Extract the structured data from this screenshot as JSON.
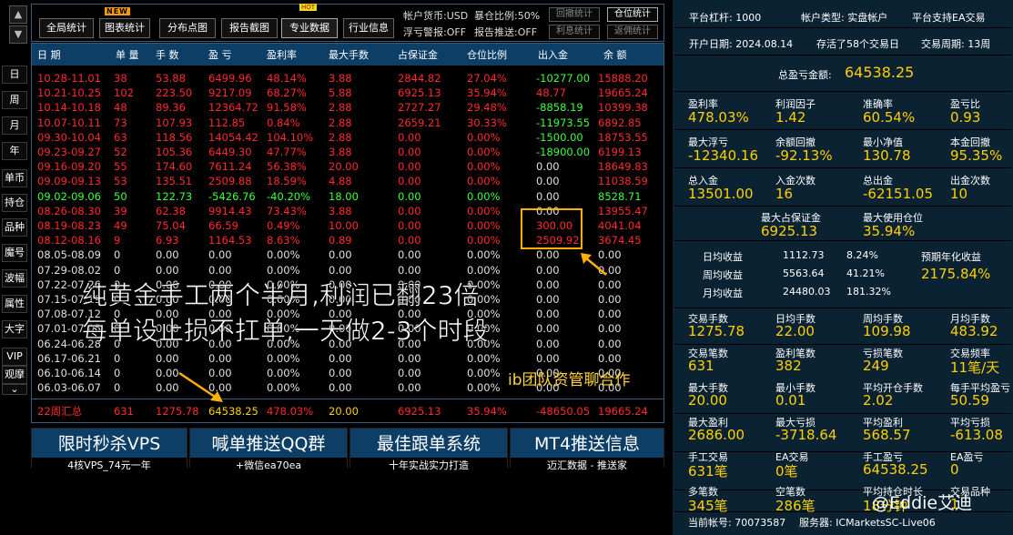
{
  "leftnav": {
    "up": "▲",
    "down": "▼",
    "items": [
      "日",
      "周",
      "月",
      "年",
      "单币",
      "持仓",
      "品种",
      "魔号",
      "波幅",
      "属性",
      "大字",
      "VIP",
      "观摩"
    ],
    "more": "⌄"
  },
  "toolbar": {
    "buttons": [
      "全局统计",
      "图表统计",
      "分布点图",
      "报告截图",
      "专业数据",
      "行业信息"
    ],
    "new_badge": "NEW",
    "hot_badge": "HOT",
    "currency": "帐户货币:USD",
    "exposure": "暴仓比例:50%",
    "floating_alert": "浮亏警报:OFF",
    "report_push": "报告推送:OFF",
    "btn_drawdown": "回撤统计",
    "btn_position": "仓位统计",
    "btn_profit": "利息统计",
    "btn_rebate": "返佣统计"
  },
  "table": {
    "headers": [
      "日 期",
      "单 量",
      "手 数",
      "盈 亏",
      "盈利率",
      "最大手数",
      "占保证金",
      "仓位比例",
      "出入金",
      "余 额"
    ],
    "rows": [
      {
        "c": "red",
        "date": "10.28-11.01",
        "orders": "38",
        "lots": "53.88",
        "pl": "6499.96",
        "rate": "48.14%",
        "maxlot": "3.88",
        "margin": "2844.82",
        "pos": "27.04%",
        "io": "-10277.00",
        "io_c": "green",
        "bal": "15888.20"
      },
      {
        "c": "red",
        "date": "10.21-10.25",
        "orders": "102",
        "lots": "223.50",
        "pl": "9217.09",
        "rate": "68.27%",
        "maxlot": "5.88",
        "margin": "6925.13",
        "pos": "35.94%",
        "io": "48.77",
        "io_c": "red",
        "bal": "19665.24"
      },
      {
        "c": "red",
        "date": "10.14-10.18",
        "orders": "48",
        "lots": "89.36",
        "pl": "12364.72",
        "rate": "91.58%",
        "maxlot": "2.88",
        "margin": "2727.27",
        "pos": "29.48%",
        "io": "-8858.19",
        "io_c": "green",
        "bal": "10399.38"
      },
      {
        "c": "red",
        "date": "10.07-10.11",
        "orders": "73",
        "lots": "107.93",
        "pl": "112.85",
        "rate": "0.84%",
        "maxlot": "2.88",
        "margin": "2659.21",
        "pos": "30.33%",
        "io": "-11973.55",
        "io_c": "green",
        "bal": "6892.85"
      },
      {
        "c": "red",
        "date": "09.30-10.04",
        "orders": "63",
        "lots": "118.56",
        "pl": "14054.42",
        "rate": "104.10%",
        "maxlot": "2.88",
        "margin": "0.00",
        "pos": "0.00%",
        "io": "-1500.00",
        "io_c": "green",
        "bal": "18753.55"
      },
      {
        "c": "red",
        "date": "09.23-09.27",
        "orders": "52",
        "lots": "105.36",
        "pl": "6449.30",
        "rate": "47.77%",
        "maxlot": "3.88",
        "margin": "0.00",
        "pos": "0.00%",
        "io": "-18900.00",
        "io_c": "green",
        "bal": "6199.13"
      },
      {
        "c": "red",
        "date": "09.16-09.20",
        "orders": "55",
        "lots": "174.60",
        "pl": "7611.24",
        "rate": "56.38%",
        "maxlot": "20.00",
        "margin": "0.00",
        "pos": "0.00%",
        "io": "0.00",
        "io_c": "gray",
        "bal": "18649.83"
      },
      {
        "c": "red",
        "date": "09.09-09.13",
        "orders": "53",
        "lots": "135.51",
        "pl": "2509.88",
        "rate": "18.59%",
        "maxlot": "4.88",
        "margin": "0.00",
        "pos": "0.00%",
        "io": "0.00",
        "io_c": "gray",
        "bal": "11038.59"
      },
      {
        "c": "green",
        "date": "09.02-09.06",
        "orders": "50",
        "lots": "122.73",
        "pl": "-5426.76",
        "rate": "-40.20%",
        "maxlot": "18.00",
        "margin": "0.00",
        "pos": "0.00%",
        "io": "0.00",
        "io_c": "gray",
        "bal": "8528.71"
      },
      {
        "c": "red",
        "date": "08.26-08.30",
        "orders": "39",
        "lots": "62.38",
        "pl": "9914.43",
        "rate": "73.43%",
        "maxlot": "3.88",
        "margin": "0.00",
        "pos": "0.00%",
        "io": "0.00",
        "io_c": "gray",
        "bal": "13955.47"
      },
      {
        "c": "red",
        "date": "08.19-08.23",
        "orders": "49",
        "lots": "75.04",
        "pl": "66.59",
        "rate": "0.49%",
        "maxlot": "10.00",
        "margin": "0.00",
        "pos": "0.00%",
        "io": "300.00",
        "io_c": "red",
        "bal": "4041.04"
      },
      {
        "c": "red",
        "date": "08.12-08.16",
        "orders": "9",
        "lots": "6.93",
        "pl": "1164.53",
        "rate": "8.63%",
        "maxlot": "0.89",
        "margin": "0.00",
        "pos": "0.00%",
        "io": "2509.92",
        "io_c": "red",
        "bal": "3674.45"
      },
      {
        "c": "gray",
        "date": "08.05-08.09",
        "orders": "0",
        "lots": "0.00",
        "pl": "0.00",
        "rate": "0.00%",
        "maxlot": "0.00",
        "margin": "0.00",
        "pos": "0.00%",
        "io": "0.00",
        "io_c": "gray",
        "bal": "0.00"
      },
      {
        "c": "gray",
        "date": "07.29-08.02",
        "orders": "0",
        "lots": "0.00",
        "pl": "0.00",
        "rate": "0.00%",
        "maxlot": "0.00",
        "margin": "0.00",
        "pos": "0.00%",
        "io": "0.00",
        "io_c": "gray",
        "bal": "0.00"
      },
      {
        "c": "gray",
        "date": "07.22-07.26",
        "orders": "0",
        "lots": "0.00",
        "pl": "0.00",
        "rate": "0.00%",
        "maxlot": "0.00",
        "margin": "0.00",
        "pos": "0.00%",
        "io": "0.00",
        "io_c": "gray",
        "bal": "0.00"
      },
      {
        "c": "gray",
        "date": "07.15-07.19",
        "orders": "0",
        "lots": "0.00",
        "pl": "0.00",
        "rate": "0.00%",
        "maxlot": "0.00",
        "margin": "0.00",
        "pos": "0.00%",
        "io": "0.00",
        "io_c": "gray",
        "bal": "0.00"
      },
      {
        "c": "gray",
        "date": "07.08-07.12",
        "orders": "0",
        "lots": "0.00",
        "pl": "0.00",
        "rate": "0.00%",
        "maxlot": "0.00",
        "margin": "0.00",
        "pos": "0.00%",
        "io": "0.00",
        "io_c": "gray",
        "bal": "0.00"
      },
      {
        "c": "gray",
        "date": "07.01-07.05",
        "orders": "0",
        "lots": "0.00",
        "pl": "0.00",
        "rate": "0.00%",
        "maxlot": "0.00",
        "margin": "0.00",
        "pos": "0.00%",
        "io": "0.00",
        "io_c": "gray",
        "bal": "0.00"
      },
      {
        "c": "gray",
        "date": "06.24-06.28",
        "orders": "0",
        "lots": "0.00",
        "pl": "0.00",
        "rate": "0.00%",
        "maxlot": "0.00",
        "margin": "0.00",
        "pos": "0.00%",
        "io": "0.00",
        "io_c": "gray",
        "bal": "0.00"
      },
      {
        "c": "gray",
        "date": "06.17-06.21",
        "orders": "0",
        "lots": "0.00",
        "pl": "0.00",
        "rate": "0.00%",
        "maxlot": "0.00",
        "margin": "0.00",
        "pos": "0.00%",
        "io": "0.00",
        "io_c": "gray",
        "bal": "0.00"
      },
      {
        "c": "gray",
        "date": "06.10-06.14",
        "orders": "0",
        "lots": "0.00",
        "pl": "0.00",
        "rate": "0.00%",
        "maxlot": "0.00",
        "margin": "0.00",
        "pos": "0.00%",
        "io": "0.00",
        "io_c": "gray",
        "bal": "0.00"
      },
      {
        "c": "gray",
        "date": "06.03-06.07",
        "orders": "0",
        "lots": "0.00",
        "pl": "0.00",
        "rate": "0.00%",
        "maxlot": "0.00",
        "margin": "0.00",
        "pos": "0.00%",
        "io": "0.00",
        "io_c": "gray",
        "bal": "0.00"
      }
    ],
    "summary": {
      "date": "22周汇总",
      "orders": "631",
      "lots": "1275.78",
      "pl": "64538.25",
      "rate": "478.03%",
      "maxlot": "20.00",
      "margin": "6925.13",
      "pos": "35.94%",
      "io": "-48650.05",
      "bal": "19665.24"
    }
  },
  "footer": [
    {
      "big": "限时秒杀VPS",
      "small": "4核VPS_74元一年"
    },
    {
      "big": "喊单推送QQ群",
      "small": "+微信ea70ea"
    },
    {
      "big": "最佳跟单系统",
      "small": "十年实战实力打造"
    },
    {
      "big": "MT4推送信息",
      "small": "迈汇数据 - 推送家"
    }
  ],
  "overlay": {
    "line1": "纯黄金手工两个半月,利润已翻23倍",
    "line2": "每单设止损不扛单,一天做2-3个时段",
    "line3": "ib团队资管聊合作"
  },
  "right": {
    "leverage": "平台杠杆:  1000",
    "acct_type": "帐户类型:  实盘帐户",
    "support": "平台支持EA交易",
    "open_date": "开户日期:  2024.08.14",
    "survived": "存活了58个交易日",
    "cycle": "交易周期:  13周",
    "total_pl_label": "总盈亏金额:",
    "total_pl": "64538.25",
    "g1": [
      {
        "l": "盈利率",
        "v": "478.03%"
      },
      {
        "l": "利润因子",
        "v": "1.42"
      },
      {
        "l": "准确率",
        "v": "60.54%"
      },
      {
        "l": "盈亏比",
        "v": "0.93"
      },
      {
        "l": "最大浮亏",
        "v": "-12340.16"
      },
      {
        "l": "余额回撤",
        "v": "-92.13%"
      },
      {
        "l": "最小净值",
        "v": "130.78"
      },
      {
        "l": "本金回撤",
        "v": "95.35%"
      },
      {
        "l": "总入金",
        "v": "13501.00"
      },
      {
        "l": "入金次数",
        "v": "16"
      },
      {
        "l": "总出金",
        "v": "-62151.05"
      },
      {
        "l": "出金次数",
        "v": "10"
      }
    ],
    "max_margin_label": "最大占保证金",
    "max_margin": "6925.13",
    "max_pos_label": "最大使用仓位",
    "max_pos": "35.94%",
    "daily_label": "日均收益",
    "daily_v": "1112.73",
    "daily_p": "8.24%",
    "weekly_label": "周均收益",
    "weekly_v": "5563.64",
    "weekly_p": "41.21%",
    "monthly_label": "月均收益",
    "monthly_v": "24480.03",
    "monthly_p": "181.32%",
    "annual_label": "预期年化收益",
    "annual": "2175.84%",
    "g2": [
      {
        "l": "交易手数",
        "v": "1275.78"
      },
      {
        "l": "日均手数",
        "v": "22.00"
      },
      {
        "l": "周均手数",
        "v": "109.98"
      },
      {
        "l": "月均手数",
        "v": "483.92"
      },
      {
        "l": "交易笔数",
        "v": "631"
      },
      {
        "l": "盈利笔数",
        "v": "382"
      },
      {
        "l": "亏损笔数",
        "v": "249"
      },
      {
        "l": "交易频率",
        "v": "11笔/天"
      },
      {
        "l": "最大手数",
        "v": "20.00"
      },
      {
        "l": "最小手数",
        "v": "0.01"
      },
      {
        "l": "平均开仓手数",
        "v": "2.02"
      },
      {
        "l": "每手平均盈亏",
        "v": "50.59"
      },
      {
        "l": "最大盈利",
        "v": "2686.00"
      },
      {
        "l": "最大亏损",
        "v": "-3718.64"
      },
      {
        "l": "平均盈利",
        "v": "568.57"
      },
      {
        "l": "平均亏损",
        "v": "-613.08"
      },
      {
        "l": "手工交易",
        "v": "631笔"
      },
      {
        "l": "EA交易",
        "v": "0笔"
      },
      {
        "l": "手工盈亏",
        "v": "64538.25"
      },
      {
        "l": "EA盈亏",
        "v": "0"
      },
      {
        "l": "多笔数",
        "v": "345笔"
      },
      {
        "l": "空笔数",
        "v": "286笔"
      },
      {
        "l": "平均持仓时长",
        "v": "18分钟"
      },
      {
        "l": "交易品种",
        "v": "1"
      }
    ],
    "account": "当前帐号:  70073587",
    "server": "服务器:  ICMarketsSC-Live06"
  },
  "watermark": "@Eddie艾迪",
  "colors": {
    "header_bg": "#0d3e66",
    "red": "#ff2a2a",
    "green": "#3bff3b",
    "yellow": "#ffd000",
    "panel_bg": "#0b2233"
  }
}
